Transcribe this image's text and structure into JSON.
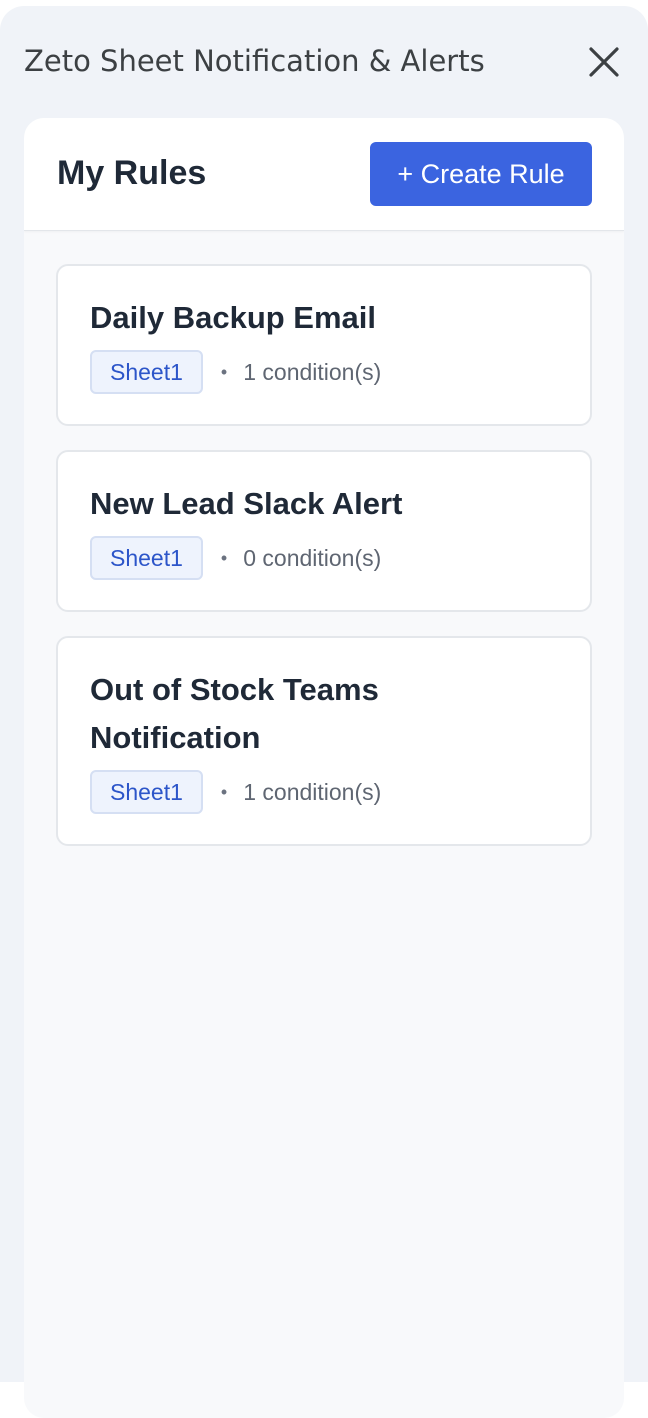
{
  "app": {
    "title": "Zeto Sheet Notification & Alerts",
    "close_icon": "close-icon"
  },
  "rules_panel": {
    "title": "My Rules",
    "create_button_label": "+ Create Rule",
    "accent_color": "#3b64e0"
  },
  "rules": [
    {
      "name": "Daily Backup Email",
      "sheet": "Sheet1",
      "separator": "•",
      "conditions": "1 condition(s)"
    },
    {
      "name": "New Lead Slack Alert",
      "sheet": "Sheet1",
      "separator": "•",
      "conditions": "0 condition(s)"
    },
    {
      "name": "Out of Stock Teams Notification",
      "sheet": "Sheet1",
      "separator": "•",
      "conditions": "1 condition(s)"
    }
  ]
}
